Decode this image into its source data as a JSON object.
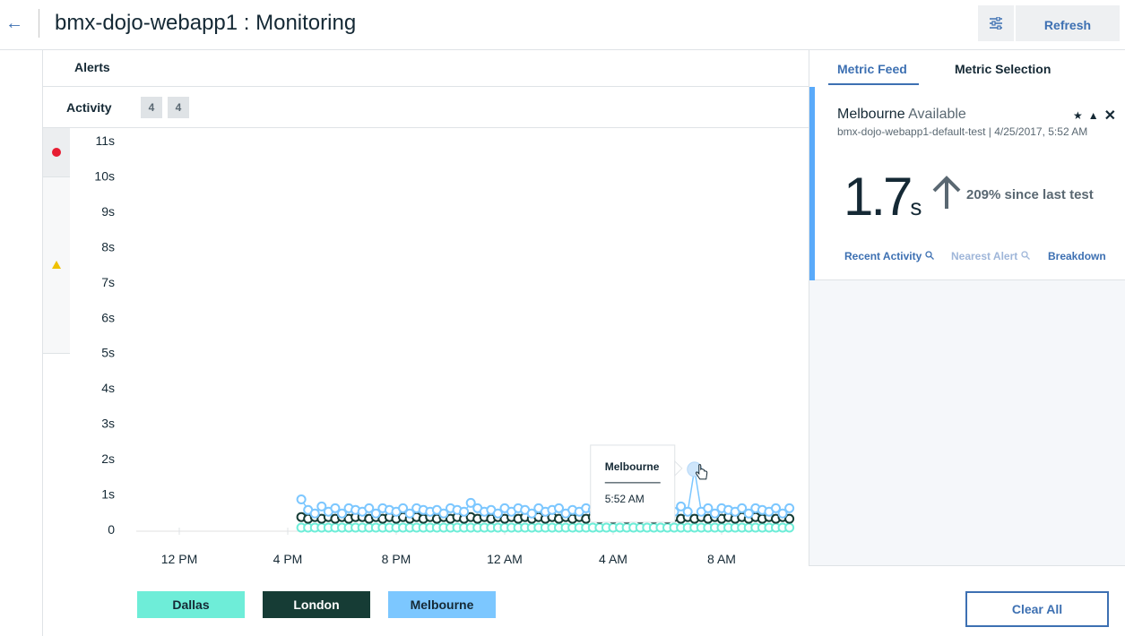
{
  "header": {
    "back_icon": "arrow-left-icon",
    "title": "bmx-dojo-webapp1 : Monitoring",
    "settings_icon": "sliders-icon",
    "refresh_label": "Refresh"
  },
  "alerts": {
    "label": "Alerts"
  },
  "activity": {
    "label": "Activity",
    "badges": [
      "4",
      "4"
    ]
  },
  "severity": {
    "critical_icon": "red-dot-icon",
    "warning_icon": "warning-triangle-icon"
  },
  "chart_data": {
    "type": "line",
    "title": "",
    "xlabel": "",
    "ylabel": "",
    "y_ticks": [
      "11s",
      "10s",
      "9s",
      "8s",
      "7s",
      "6s",
      "5s",
      "4s",
      "3s",
      "2s",
      "1s",
      "0"
    ],
    "ylim": [
      0,
      11
    ],
    "x_ticks": [
      "12 PM",
      "4 PM",
      "8 PM",
      "12 AM",
      "4 AM",
      "8 AM"
    ],
    "x_tick_hours": [
      0,
      4,
      8,
      12,
      16,
      20
    ],
    "grid": false,
    "legend_position": "bottom-left",
    "series": [
      {
        "name": "Dallas",
        "color": "#6eedd8",
        "x_hours": [
          4.5,
          4.75,
          5.0,
          5.25,
          5.5,
          5.75,
          6.0,
          6.25,
          6.5,
          6.75,
          7.0,
          7.25,
          7.5,
          7.75,
          8.0,
          8.25,
          8.5,
          8.75,
          9.0,
          9.25,
          9.5,
          9.75,
          10.0,
          10.25,
          10.5,
          10.75,
          11.0,
          11.25,
          11.5,
          11.75,
          12.0,
          12.25,
          12.5,
          12.75,
          13.0,
          13.25,
          13.5,
          13.75,
          14.0,
          14.25,
          14.5,
          14.75,
          15.0,
          15.25,
          15.5,
          15.75,
          16.0,
          16.25,
          16.5,
          16.75,
          17.0,
          17.25,
          17.5,
          17.75,
          18.0,
          18.25,
          18.5,
          18.75,
          19.0,
          19.25,
          19.5,
          19.75,
          20.0,
          20.25,
          20.5,
          20.75,
          21.0,
          21.25,
          21.5,
          21.75,
          22.0,
          22.25,
          22.5
        ],
        "values": [
          0.05,
          0.05,
          0.05,
          0.05,
          0.05,
          0.05,
          0.05,
          0.05,
          0.05,
          0.05,
          0.05,
          0.05,
          0.05,
          0.05,
          0.05,
          0.05,
          0.05,
          0.05,
          0.05,
          0.05,
          0.05,
          0.05,
          0.05,
          0.05,
          0.05,
          0.05,
          0.05,
          0.05,
          0.05,
          0.05,
          0.05,
          0.05,
          0.05,
          0.05,
          0.05,
          0.05,
          0.05,
          0.05,
          0.05,
          0.05,
          0.05,
          0.05,
          0.05,
          0.05,
          0.05,
          0.05,
          0.05,
          0.05,
          0.05,
          0.05,
          0.05,
          0.05,
          0.05,
          0.05,
          0.05,
          0.05,
          0.05,
          0.05,
          0.05,
          0.05,
          0.05,
          0.05,
          0.05,
          0.05,
          0.05,
          0.05,
          0.05,
          0.05,
          0.05,
          0.05,
          0.05,
          0.05,
          0.05
        ]
      },
      {
        "name": "London",
        "color": "#163c35",
        "x_hours": [
          4.5,
          4.75,
          5.0,
          5.25,
          5.5,
          5.75,
          6.0,
          6.25,
          6.5,
          6.75,
          7.0,
          7.25,
          7.5,
          7.75,
          8.0,
          8.25,
          8.5,
          8.75,
          9.0,
          9.25,
          9.5,
          9.75,
          10.0,
          10.25,
          10.5,
          10.75,
          11.0,
          11.25,
          11.5,
          11.75,
          12.0,
          12.25,
          12.5,
          12.75,
          13.0,
          13.25,
          13.5,
          13.75,
          14.0,
          14.25,
          14.5,
          14.75,
          15.0,
          15.25,
          15.5,
          15.75,
          16.0,
          16.25,
          16.5,
          16.75,
          17.0,
          17.25,
          17.5,
          17.75,
          18.0,
          18.25,
          18.5,
          18.75,
          19.0,
          19.25,
          19.5,
          19.75,
          20.0,
          20.25,
          20.5,
          20.75,
          21.0,
          21.25,
          21.5,
          21.75,
          22.0,
          22.25,
          22.5
        ],
        "values": [
          0.35,
          0.3,
          0.35,
          0.3,
          0.35,
          0.3,
          0.35,
          0.3,
          0.35,
          0.35,
          0.3,
          0.35,
          0.3,
          0.35,
          0.3,
          0.35,
          0.3,
          0.35,
          0.3,
          0.35,
          0.3,
          0.35,
          0.3,
          0.35,
          0.3,
          0.35,
          0.3,
          0.35,
          0.3,
          0.35,
          0.3,
          0.35,
          0.3,
          0.35,
          0.3,
          0.35,
          0.3,
          0.35,
          0.3,
          0.35,
          0.3,
          0.35,
          0.3,
          0.35,
          0.3,
          0.35,
          0.3,
          0.35,
          0.3,
          0.35,
          0.3,
          0.35,
          0.3,
          0.35,
          0.3,
          0.35,
          0.3,
          0.35,
          0.3,
          0.35,
          0.3,
          0.35,
          0.3,
          0.35,
          0.3,
          0.35,
          0.3,
          0.35,
          0.3,
          0.35,
          0.3,
          0.35,
          0.3
        ]
      },
      {
        "name": "Melbourne",
        "color": "#7cc7ff",
        "x_hours": [
          4.5,
          4.75,
          5.0,
          5.25,
          5.5,
          5.75,
          6.0,
          6.25,
          6.5,
          6.75,
          7.0,
          7.25,
          7.5,
          7.75,
          8.0,
          8.25,
          8.5,
          8.75,
          9.0,
          9.25,
          9.5,
          9.75,
          10.0,
          10.25,
          10.5,
          10.75,
          11.0,
          11.25,
          11.5,
          11.75,
          12.0,
          12.25,
          12.5,
          12.75,
          13.0,
          13.25,
          13.5,
          13.75,
          14.0,
          14.25,
          14.5,
          14.75,
          15.0,
          15.25,
          15.5,
          15.75,
          16.0,
          16.25,
          16.5,
          16.75,
          17.0,
          17.25,
          17.5,
          17.75,
          18.0,
          18.25,
          18.5,
          18.75,
          19.0,
          19.25,
          19.5,
          19.75,
          20.0,
          20.25,
          20.5,
          20.75,
          21.0,
          21.25,
          21.5,
          21.75,
          22.0,
          22.25,
          22.5
        ],
        "values": [
          0.85,
          0.55,
          0.45,
          0.65,
          0.5,
          0.6,
          0.45,
          0.6,
          0.55,
          0.5,
          0.6,
          0.45,
          0.6,
          0.55,
          0.5,
          0.6,
          0.45,
          0.6,
          0.55,
          0.5,
          0.55,
          0.45,
          0.6,
          0.55,
          0.5,
          0.75,
          0.6,
          0.5,
          0.55,
          0.45,
          0.6,
          0.5,
          0.6,
          0.55,
          0.45,
          0.6,
          0.5,
          0.55,
          0.6,
          0.45,
          0.55,
          0.5,
          0.6,
          0.55,
          0.45,
          0.6,
          0.5,
          0.55,
          0.6,
          0.45,
          0.5,
          0.55,
          0.6,
          0.45,
          0.55,
          0.5,
          0.65,
          0.5,
          1.7,
          0.5,
          0.6,
          0.45,
          0.6,
          0.55,
          0.5,
          0.6,
          0.45,
          0.6,
          0.55,
          0.5,
          0.6,
          0.45,
          0.6
        ]
      }
    ],
    "tooltip": {
      "title": "Melbourne",
      "time": "5:52 AM"
    }
  },
  "legend": [
    {
      "label": "Dallas",
      "bg": "#6eedd8",
      "fg": "#152935"
    },
    {
      "label": "London",
      "bg": "#163c35",
      "fg": "#ffffff"
    },
    {
      "label": "Melbourne",
      "bg": "#7cc7ff",
      "fg": "#152935"
    }
  ],
  "clear_all_label": "Clear All",
  "right_panel": {
    "tabs": [
      "Metric Feed",
      "Metric Selection"
    ],
    "card": {
      "location": "Melbourne",
      "status": "Available",
      "subtitle": "bmx-dojo-webapp1-default-test | 4/25/2017, 5:52 AM",
      "value": "1.7",
      "unit": "s",
      "change": "209% since last test",
      "icons": [
        "star-icon",
        "triangle-up-icon",
        "close-icon"
      ],
      "links": [
        "Recent Activity",
        "Nearest Alert",
        "Breakdown"
      ]
    }
  }
}
